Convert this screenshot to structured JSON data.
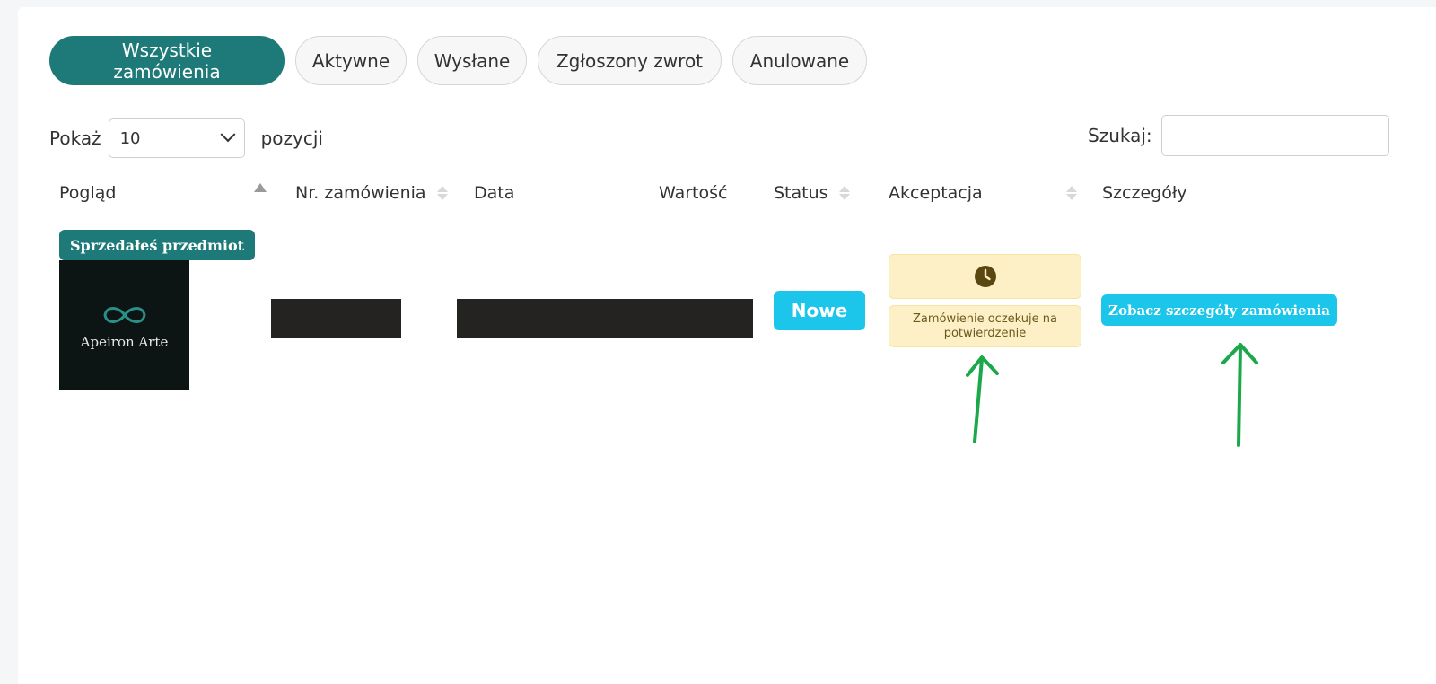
{
  "tabs": [
    {
      "label": "Wszystkie zamówienia",
      "active": true
    },
    {
      "label": "Aktywne",
      "active": false
    },
    {
      "label": "Wysłane",
      "active": false
    },
    {
      "label": "Zgłoszony zwrot",
      "active": false
    },
    {
      "label": "Anulowane",
      "active": false
    }
  ],
  "length": {
    "prefix": "Pokaż",
    "value": "10",
    "suffix": "pozycji"
  },
  "search": {
    "label": "Szukaj:",
    "value": ""
  },
  "columns": [
    "Pogląd",
    "Nr. zamówienia",
    "Data",
    "Wartość",
    "Status",
    "Akceptacja",
    "Szczegóły"
  ],
  "row": {
    "badge": "Sprzedałeś przedmiot",
    "thumb_name": "Apeiron Arte",
    "status": "Nowe",
    "acceptance": "Zamówienie oczekuje na potwierdzenie",
    "details_button": "Zobacz szczegóły zamówienia"
  },
  "colors": {
    "accent": "#1d7a78",
    "info": "#1cc6eb",
    "warning_bg": "#fdf0c6",
    "arrow": "#1aa84a"
  },
  "icons": {
    "acceptance": "clock-icon",
    "logo": "infinity-icon"
  }
}
